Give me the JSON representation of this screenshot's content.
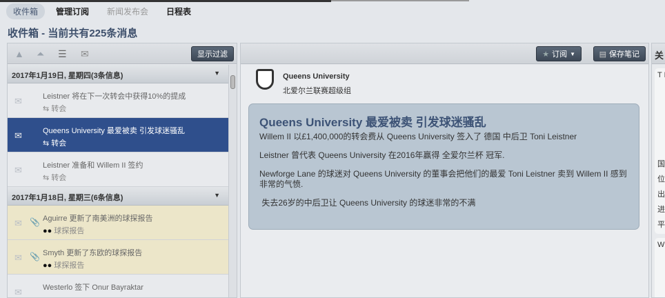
{
  "tabs": [
    "收件箱",
    "管理订阅",
    "新闻发布会",
    "日程表"
  ],
  "title": "收件箱 - 当前共有225条消息",
  "left": {
    "filter_button": "显示过滤",
    "groups": [
      {
        "date": "2017年1月19日, 星期四(3条信息)",
        "items": [
          {
            "subject": "Leistner 将在下一次转会中获得10%的提成",
            "category": "转会"
          },
          {
            "subject": "Queens University 最爱被卖 引发球迷骚乱",
            "category": "转会"
          },
          {
            "subject": "Leistner 准备和 Willem II 签约",
            "category": "转会"
          }
        ]
      },
      {
        "date": "2017年1月18日, 星期三(6条信息)",
        "items": [
          {
            "subject": "Aguirre 更新了南美洲的球探报告",
            "category": "球探报告"
          },
          {
            "subject": "Smyth 更新了东欧的球探报告",
            "category": "球探报告"
          },
          {
            "subject": "Westerlo 签下 Onur Bayraktar",
            "category": ""
          }
        ]
      }
    ]
  },
  "message": {
    "subscribe_button": "订阅",
    "save_note_button": "保存笔记",
    "club": "Queens University",
    "league": "北爱尔兰联赛超级组",
    "headline": "Queens University 最爱被卖 引发球迷骚乱",
    "paragraphs": [
      "Willem II 以£1,400,000的转会费从 Queens University 签入了 德国 中后卫 Toni Leistner",
      "Leistner 曾代表 Queens University 在2016年赢得 全爱尔兰杯 冠军.",
      "Newforge Lane 的球迷对 Queens University 的董事会把他们的最爱 Toni Leistner 卖到 Willem II 感到非常的气愤.",
      " 失去26岁的中后卫让 Queens University 的球迷非常的不满"
    ]
  },
  "right": {
    "header": "关",
    "card1": "T L",
    "rows": [
      "国",
      "位",
      "出",
      "进",
      "平"
    ],
    "card2": "Wi"
  }
}
